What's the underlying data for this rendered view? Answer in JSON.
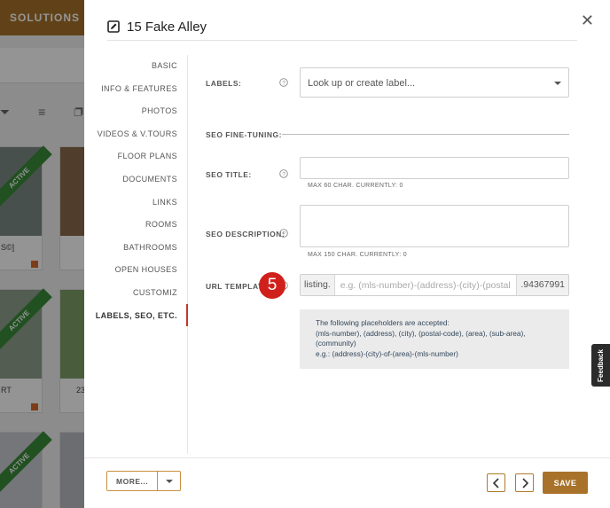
{
  "background": {
    "brand": "SOLUTIONS",
    "tools": "⏷ ≡ ❐ ↻",
    "ribbon": "ACTIVE",
    "card_texts": [
      "S©]",
      "RT",
      "23"
    ]
  },
  "modal": {
    "title": "15 Fake Alley",
    "nav": [
      "BASIC",
      "INFO & FEATURES",
      "PHOTOS",
      "VIDEOS & V.TOURS",
      "FLOOR PLANS",
      "DOCUMENTS",
      "LINKS",
      "ROOMS",
      "BATHROOMS",
      "OPEN HOUSES",
      "CUSTOMIZ",
      "LABELS, SEO, ETC."
    ],
    "labels_field": {
      "label": "LABELS:",
      "placeholder": "Look up or create label..."
    },
    "seo_section": "SEO FINE-TUNING:",
    "seo_title": {
      "label": "SEO TITLE:",
      "hint": "MAX 60 CHAR. CURRENTLY: 0"
    },
    "seo_description": {
      "label": "SEO DESCRIPTION:",
      "hint": "MAX 150 CHAR. CURRENTLY: 0"
    },
    "url_template": {
      "label": "URL TEMPLATE:",
      "prefix": "listing.",
      "placeholder": "e.g. (mls-number)-(address)-(city)-(postal-",
      "suffix": ".94367991"
    },
    "info": {
      "line1": "The following placeholders are accepted:",
      "line2": "(mls-number), (address), (city), (postal-code), (area), (sub-area),",
      "line3": "(community)",
      "line4": "e.g.: (address)-(city)-of-(area)-(mls-number)"
    },
    "step_badge": "5",
    "footer": {
      "more_label": "MORE...",
      "save_label": "SAVE"
    }
  },
  "feedback": "Feedback",
  "colors": {
    "brand": "#a8722a",
    "active_ribbon": "#3a8a3a",
    "step_badge": "#d0201c"
  }
}
